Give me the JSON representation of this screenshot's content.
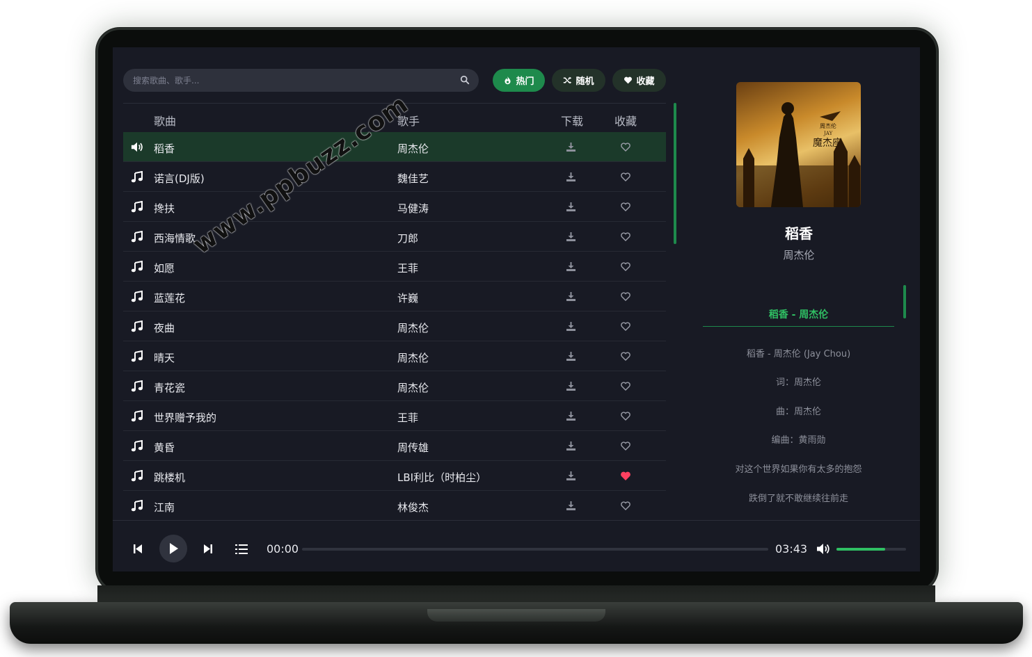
{
  "search": {
    "placeholder": "搜索歌曲、歌手..."
  },
  "filters": {
    "hot": "热门",
    "random": "随机",
    "favorites": "收藏"
  },
  "table": {
    "headers": {
      "song": "歌曲",
      "artist": "歌手",
      "download": "下载",
      "favorite": "收藏"
    },
    "rows": [
      {
        "title": "稻香",
        "artist": "周杰伦",
        "playing": true,
        "favorited": false
      },
      {
        "title": "诺言(DJ版)",
        "artist": "魏佳艺",
        "playing": false,
        "favorited": false
      },
      {
        "title": "搀扶",
        "artist": "马健涛",
        "playing": false,
        "favorited": false
      },
      {
        "title": "西海情歌",
        "artist": "刀郎",
        "playing": false,
        "favorited": false
      },
      {
        "title": "如愿",
        "artist": "王菲",
        "playing": false,
        "favorited": false
      },
      {
        "title": "蓝莲花",
        "artist": "许巍",
        "playing": false,
        "favorited": false
      },
      {
        "title": "夜曲",
        "artist": "周杰伦",
        "playing": false,
        "favorited": false
      },
      {
        "title": "晴天",
        "artist": "周杰伦",
        "playing": false,
        "favorited": false
      },
      {
        "title": "青花瓷",
        "artist": "周杰伦",
        "playing": false,
        "favorited": false
      },
      {
        "title": "世界赠予我的",
        "artist": "王菲",
        "playing": false,
        "favorited": false
      },
      {
        "title": "黄昏",
        "artist": "周传雄",
        "playing": false,
        "favorited": false
      },
      {
        "title": "跳楼机",
        "artist": "LBI利比（时柏尘）",
        "playing": false,
        "favorited": true
      },
      {
        "title": "江南",
        "artist": "林俊杰",
        "playing": false,
        "favorited": false
      }
    ]
  },
  "now_playing": {
    "title": "稻香",
    "artist": "周杰伦",
    "cover_text": {
      "line1": "周杰伦",
      "line2": "JAY",
      "line3": "魔杰座"
    }
  },
  "lyrics": {
    "current": "稻香 - 周杰伦",
    "lines": [
      "稻香 - 周杰伦 (Jay Chou)",
      "词：周杰伦",
      "曲：周杰伦",
      "编曲：黄雨勋",
      "对这个世界如果你有太多的抱怨",
      "跌倒了就不敢继续往前走"
    ]
  },
  "player": {
    "current_time": "00:00",
    "total_time": "03:43",
    "progress": 0,
    "volume": 0.7
  },
  "watermark": "www.ppbuzz.com",
  "colors": {
    "accent": "#1e8a4c",
    "accent_text": "#2fbf63",
    "favorite_active": "#ff4060",
    "background": "#181a24"
  },
  "icons": {
    "row_playing": "volume-icon",
    "row_idle": "music-note-icon",
    "download": "download-icon",
    "favorite": "heart-icon"
  }
}
